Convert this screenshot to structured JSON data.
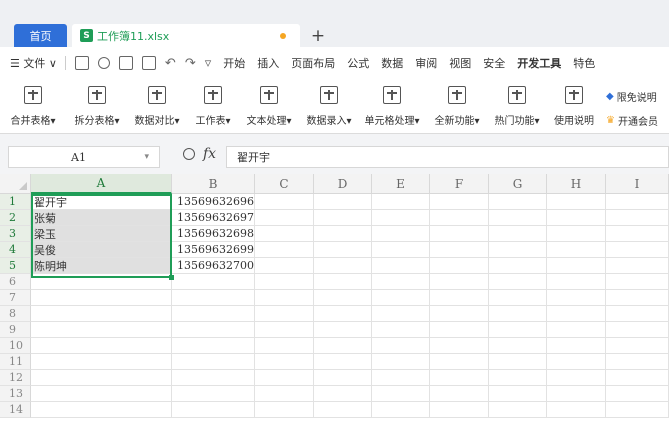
{
  "tabs": {
    "home": "首页",
    "file_icon_letter": "S",
    "file_name": "工作簿11.xlsx",
    "add": "+"
  },
  "menu": {
    "file": "☰ 文件 ∨",
    "items": [
      "开始",
      "插入",
      "页面布局",
      "公式",
      "数据",
      "审阅",
      "视图",
      "安全",
      "开发工具",
      "特色"
    ]
  },
  "ribbon": {
    "buttons": [
      "合并表格▾",
      "拆分表格▾",
      "数据对比▾",
      "工作表▾",
      "文本处理▾",
      "数据录入▾",
      "单元格处理▾",
      "全新功能▾",
      "热门功能▾",
      "使用说明"
    ],
    "free_manual": "限免说明",
    "open_member": "开通会员"
  },
  "formula_bar": {
    "cell_ref": "A1",
    "fx": "fx",
    "content": "翟开宇"
  },
  "grid": {
    "columns": [
      "A",
      "B",
      "C",
      "D",
      "E",
      "F",
      "G",
      "H",
      "I"
    ],
    "rows": [
      "1",
      "2",
      "3",
      "4",
      "5",
      "6",
      "7",
      "8",
      "9",
      "10",
      "11",
      "12",
      "13",
      "14"
    ],
    "names": [
      "翟开宇",
      "张菊",
      "梁玉",
      "吴俊",
      "陈明坤"
    ],
    "phones": [
      "13569632696",
      "13569632697",
      "13569632698",
      "13569632699",
      "13569632700"
    ]
  },
  "colors": {
    "accent_blue": "#2f6fd8",
    "sheet_green": "#1f9d57",
    "unsaved_dot": "#f5a623"
  }
}
